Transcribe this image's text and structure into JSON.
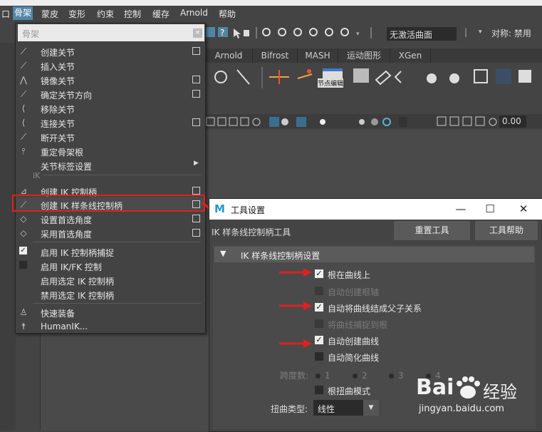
{
  "menubar": {
    "items": [
      "口",
      "骨架",
      "蒙皮",
      "变形",
      "约束",
      "控制",
      "缓存",
      "Arnold",
      "帮助"
    ],
    "active_index": 1
  },
  "toolbar": {
    "curve_field": "无激活曲面",
    "symmetry": "对称: 禁用"
  },
  "left_label": "装备",
  "shelf_tabs": [
    "Arnold",
    "Bifrost",
    "MASH",
    "运动图形",
    "XGen"
  ],
  "shelf_icons": {
    "node_editor_label": "节点编辑"
  },
  "panel_toolbar": {
    "value": "0.00"
  },
  "menu": {
    "search_placeholder": "骨架",
    "clear_glyph": "×",
    "joints": [
      {
        "label": "创建关节",
        "option_box": true
      },
      {
        "label": "插入关节",
        "option_box": false
      },
      {
        "label": "镜像关节",
        "option_box": true
      },
      {
        "label": "确定关节方向",
        "option_box": true
      },
      {
        "label": "移除关节",
        "option_box": false
      },
      {
        "label": "连接关节",
        "option_box": true
      },
      {
        "label": "断开关节",
        "option_box": false
      },
      {
        "label": "重定骨架根",
        "option_box": false
      },
      {
        "label": "关节标签设置",
        "submenu": true
      }
    ],
    "ik_section": "IK",
    "ik": [
      {
        "label": "创建 IK 控制柄",
        "option_box": true
      },
      {
        "label": "创建 IK 样条线控制柄",
        "option_box": true
      },
      {
        "label": "设置首选角度",
        "option_box": true
      },
      {
        "label": "采用首选角度",
        "option_box": true
      }
    ],
    "toggles": [
      {
        "label": "启用 IK 控制柄捕捉",
        "checked": true
      },
      {
        "label": "启用 IK/FK 控制",
        "checked": false
      },
      {
        "label": "启用选定 IK 控制柄",
        "checked": false
      },
      {
        "label": "禁用选定 IK 控制柄",
        "checked": false
      }
    ],
    "rigging": [
      {
        "label": "快速装备"
      },
      {
        "label": "HumanIK..."
      }
    ]
  },
  "dialog": {
    "title": "工具设置",
    "logo": "M",
    "tool_name": "IK 样条线控制柄工具",
    "reset_button": "重置工具",
    "help_button": "工具帮助",
    "section_title": "IK 样条线控制柄设置",
    "options": [
      {
        "label": "根在曲线上",
        "checked": true,
        "enabled": true
      },
      {
        "label": "自动创建根轴",
        "checked": false,
        "enabled": false
      },
      {
        "label": "自动将曲线结成父子关系",
        "checked": true,
        "enabled": true
      },
      {
        "label": "将曲线捕捉到根",
        "checked": false,
        "enabled": false
      },
      {
        "label": "自动创建曲线",
        "checked": true,
        "enabled": true
      },
      {
        "label": "自动简化曲线",
        "checked": false,
        "enabled": true
      }
    ],
    "span_label": "跨度数:",
    "span_options": [
      "1",
      "2",
      "3",
      "4"
    ],
    "twist_option": {
      "label": "根扭曲模式",
      "checked": false
    },
    "twist_type_label": "扭曲类型:",
    "twist_type_value": "线性",
    "window_buttons": [
      "—",
      "☐",
      "✕"
    ]
  },
  "watermark": {
    "brand": "Bai",
    "brand2": "经验",
    "url": "jingyan.baidu.com"
  },
  "colors": {
    "highlight": "#5285a6",
    "annotation_red": "#e02020",
    "maya_blue": "#1f9bd1"
  }
}
